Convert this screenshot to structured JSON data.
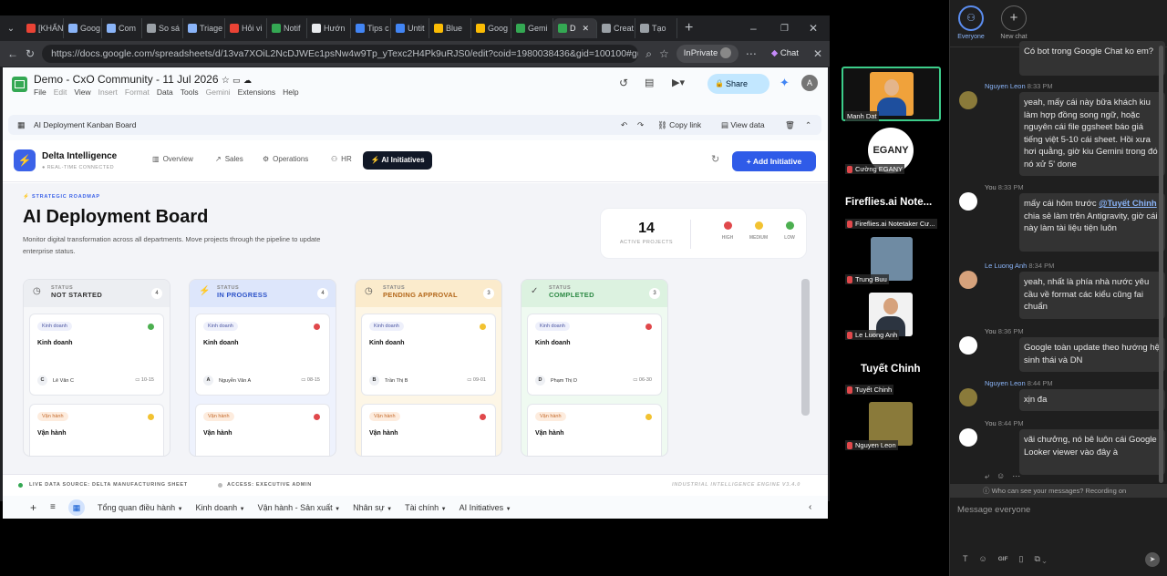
{
  "browser": {
    "tabs": [
      {
        "label": "[KHẨN",
        "color": "#ea4335"
      },
      {
        "label": "Goog",
        "color": "#8ab4f8"
      },
      {
        "label": "Com",
        "color": "#8ab4f8"
      },
      {
        "label": "So sá",
        "color": "#9aa0a6"
      },
      {
        "label": "Triage",
        "color": "#8ab4f8"
      },
      {
        "label": "Hỏi vi",
        "color": "#ea4335"
      },
      {
        "label": "Notif",
        "color": "#34a853"
      },
      {
        "label": "Hướn",
        "color": "#e8eaed"
      },
      {
        "label": "Tips c",
        "color": "#4285f4"
      },
      {
        "label": "Untit",
        "color": "#4285f4"
      },
      {
        "label": "Blue",
        "color": "#fbbc04"
      },
      {
        "label": "Goog",
        "color": "#fbbc04"
      },
      {
        "label": "Gemi",
        "color": "#34a853"
      },
      {
        "label": "D",
        "color": "#34a853"
      },
      {
        "label": "Creat",
        "color": "#9aa0a6"
      },
      {
        "label": "Tạo",
        "color": "#9aa0a6"
      }
    ],
    "url": "https://docs.google.com/spreadsheets/d/13va7XOiL2NcDJWEc1psNw4w9Tp_yTexc2H4Pk9uRJS0/edit?coid=1980038436&gid=100100#gid=...",
    "inprivate": "InPrivate",
    "chat": "Chat"
  },
  "sheet": {
    "title": "Demo - CxO Community - 11 Jul 2026",
    "menus": [
      "File",
      "Edit",
      "View",
      "Insert",
      "Format",
      "Data",
      "Tools",
      "Gemini",
      "Extensions",
      "Help"
    ],
    "share": "Share",
    "avatar": "A",
    "embed_title": "AI Deployment Kanban Board",
    "copy_link": "Copy link",
    "view_data": "View data",
    "sheet_tabs": [
      "Tổng quan điều hành",
      "Kinh doanh",
      "Vận hành - Sản xuất",
      "Nhân sự",
      "Tài chính",
      "AI Initiatives"
    ]
  },
  "app": {
    "brand": "Delta Intelligence",
    "brand_sub": "● REAL-TIME CONNECTED",
    "nav": [
      "Overview",
      "Sales",
      "Operations",
      "HR",
      "AI Initiatives"
    ],
    "add_btn": "Add Initiative",
    "kicker": "STRATEGIC ROADMAP",
    "heading": "AI Deployment Board",
    "desc": "Monitor digital transformation across all departments. Move projects through the pipeline to update enterprise status.",
    "active_count": "14",
    "active_label": "ACTIVE PROJECTS",
    "legend": [
      {
        "label": "HIGH",
        "color": "#e0484b"
      },
      {
        "label": "MEDIUM",
        "color": "#f2c231"
      },
      {
        "label": "LOW",
        "color": "#4caf50"
      }
    ],
    "footer_left": "LIVE DATA SOURCE: DELTA MANUFACTURING SHEET",
    "footer_mid": "ACCESS: EXECUTIVE ADMIN",
    "footer_right": "INDUSTRIAL INTELLIGENCE ENGINE V3.4.0",
    "columns": [
      {
        "status": "STATUS",
        "name": "NOT STARTED",
        "count": "4",
        "head_bg": "#eceef2",
        "body_bg": "#f6f7f9",
        "name_color": "#333",
        "cards": [
          {
            "tag": "Kinh doanh",
            "title": "Kinh doanh",
            "priority": "#4caf50",
            "initial": "C",
            "person": "Lê Văn C",
            "date": "10-15"
          },
          {
            "tag": "Vận hành",
            "title": "Vận hành",
            "priority": "#f2c231"
          }
        ]
      },
      {
        "status": "STATUS",
        "name": "IN PROGRESS",
        "count": "4",
        "head_bg": "#dde6fb",
        "body_bg": "#eef2fd",
        "name_color": "#2f55c9",
        "cards": [
          {
            "tag": "Kinh doanh",
            "title": "Kinh doanh",
            "priority": "#e0484b",
            "initial": "A",
            "person": "Nguyễn Văn A",
            "date": "08-15"
          },
          {
            "tag": "Vận hành",
            "title": "Vận hành",
            "priority": "#e0484b"
          }
        ]
      },
      {
        "status": "STATUS",
        "name": "PENDING APPROVAL",
        "count": "3",
        "head_bg": "#fbebcc",
        "body_bg": "#fdf6e6",
        "name_color": "#b3671a",
        "cards": [
          {
            "tag": "Kinh doanh",
            "title": "Kinh doanh",
            "priority": "#f2c231",
            "initial": "B",
            "person": "Trần Thị B",
            "date": "09-01"
          },
          {
            "tag": "Vận hành",
            "title": "Vận hành",
            "priority": "#e0484b"
          }
        ]
      },
      {
        "status": "STATUS",
        "name": "COMPLETED",
        "count": "3",
        "head_bg": "#dcf2e0",
        "body_bg": "#effaf1",
        "name_color": "#2e8a45",
        "cards": [
          {
            "tag": "Kinh doanh",
            "title": "Kinh doanh",
            "priority": "#e0484b",
            "initial": "D",
            "person": "Phạm Thị D",
            "date": "06-30"
          },
          {
            "tag": "Vận hành",
            "title": "Vận hành",
            "priority": "#f2c231"
          }
        ]
      }
    ]
  },
  "participants": [
    {
      "name": "Manh Dat"
    },
    {
      "name": "Cường EGANY",
      "logo": "EGANY"
    },
    {
      "name": "Fireflies.ai Notetaker Cư...",
      "heading": "Fireflies.ai Note..."
    },
    {
      "name": "Trung Buu"
    },
    {
      "name": "Le Luong Anh"
    },
    {
      "name": "Tuyết Chinh",
      "heading": "Tuyết Chinh"
    },
    {
      "name": "Nguyen Leon"
    }
  ],
  "chat": {
    "everyone": "Everyone",
    "new_chat": "New chat",
    "messages": [
      {
        "text": "Có bot trong Google Chat ko em?"
      },
      {
        "name": "Nguyen Leon",
        "time": "8:33 PM",
        "text": "yeah, mấy cái này bữa khách kiu làm hợp đồng song ngữ, hoặc nguyên cái file ggsheet báo giá tiếng việt 5-10 cái sheet. Hồi xưa hơi quằng, giờ  kiu Gemini trong đó nó xử 5' done"
      },
      {
        "name": "You",
        "time": "8:33 PM",
        "pre": "mấy cái hôm trước ",
        "mention": "@Tuyết Chinh",
        "post": " chia sẻ làm trên Antigravity, giờ cái này làm tài liệu tiện luôn"
      },
      {
        "name": "Le Luong Anh",
        "time": "8:34 PM",
        "text": "yeah, nhất là phía nhà nước yêu cầu về format các kiểu cũng fai chuẩn"
      },
      {
        "name": "You",
        "time": "8:36 PM",
        "text": "Google toàn update theo hướng hệ sinh thái và DN"
      },
      {
        "name": "Nguyen Leon",
        "time": "8:44 PM",
        "text": "xịn đa"
      },
      {
        "name": "You",
        "time": "8:44 PM",
        "text": "vãi chưởng, nó bê luôn cái Google Looker viewer vào đây à"
      }
    ],
    "recording": "Who can see your messages? Recording on",
    "input_placeholder": "Message everyone",
    "gif": "GIF"
  }
}
